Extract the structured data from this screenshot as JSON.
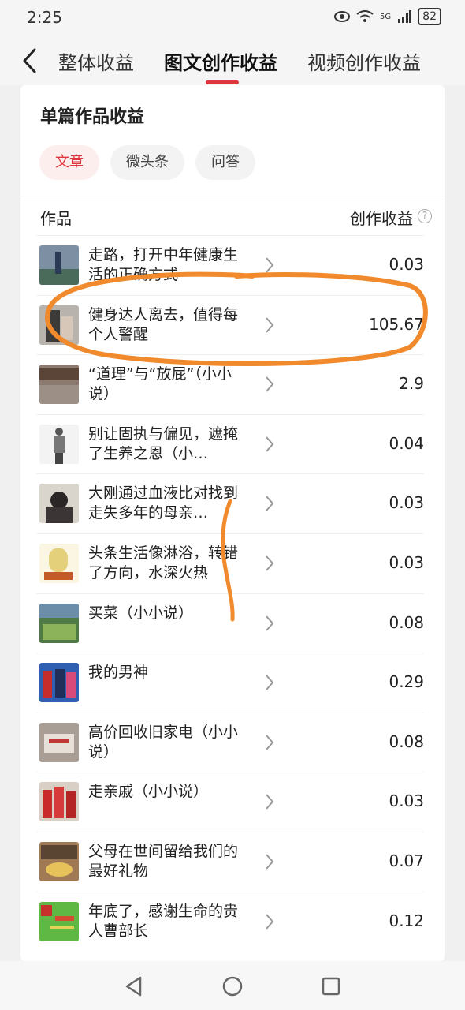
{
  "status": {
    "time": "2:25",
    "battery": "82",
    "network": "5G"
  },
  "tabs": [
    {
      "label": "整体收益",
      "active": false
    },
    {
      "label": "图文创作收益",
      "active": true
    },
    {
      "label": "视频创作收益",
      "active": false
    }
  ],
  "card": {
    "title": "单篇作品收益",
    "chips": [
      "文章",
      "微头条",
      "问答"
    ],
    "col_work": "作品",
    "col_income": "创作收益",
    "help_glyph": "?"
  },
  "rows": [
    {
      "title": "走路，打开中年健康生活的正确方式",
      "value": "0.03"
    },
    {
      "title": "健身达人离去，值得每个人警醒",
      "value": "105.67"
    },
    {
      "title": "“道理”与“放屁”（小小说）",
      "value": "2.9"
    },
    {
      "title": "别让固执与偏见，遮掩了生养之恩（小…",
      "value": "0.04"
    },
    {
      "title": "大刚通过血液比对找到走失多年的母亲…",
      "value": "0.03"
    },
    {
      "title": "头条生活像淋浴，转错了方向，水深火热",
      "value": "0.03"
    },
    {
      "title": "买菜（小小说）",
      "value": "0.08"
    },
    {
      "title": "我的男神",
      "value": "0.29"
    },
    {
      "title": "高价回收旧家电（小小说）",
      "value": "0.08"
    },
    {
      "title": "走亲戚（小小说）",
      "value": "0.03"
    },
    {
      "title": "父母在世间留给我们的最好礼物",
      "value": "0.07"
    },
    {
      "title": "年底了，感谢生命的贵人曹部长",
      "value": "0.12"
    }
  ],
  "colors": {
    "accent": "#e0373f",
    "annotation": "#f08a2c"
  }
}
